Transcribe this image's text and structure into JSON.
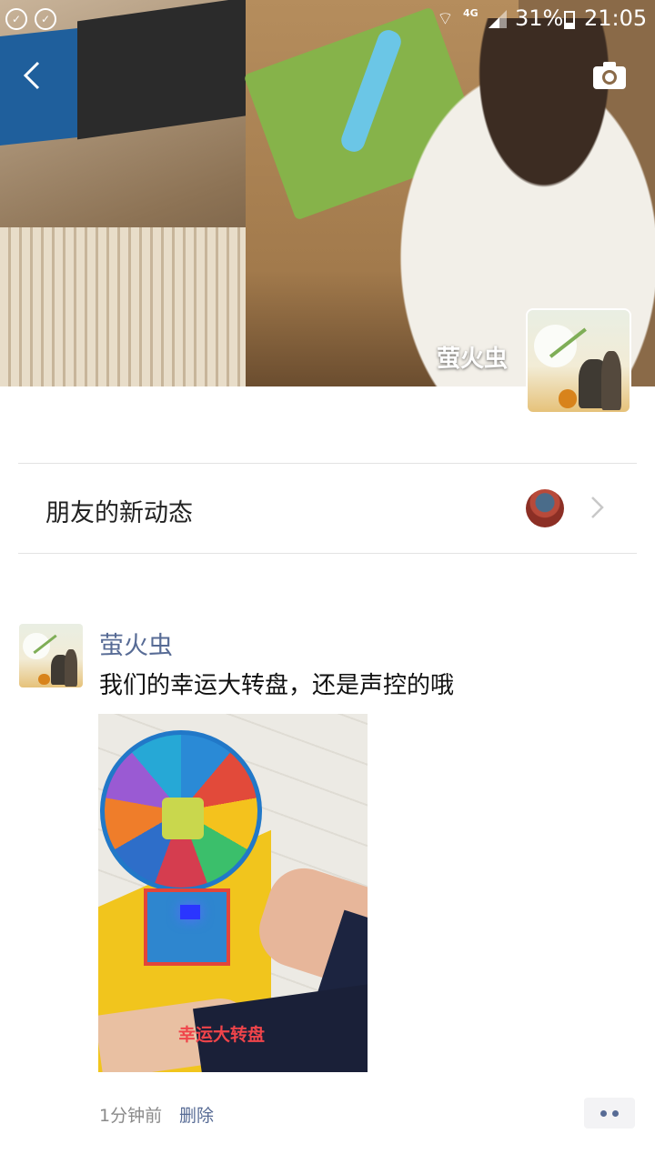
{
  "status_bar": {
    "network": "4G",
    "battery_percent": "31%",
    "battery_level": 0.31,
    "time": "21:05",
    "notification_icons": [
      "notification-icon",
      "notification-icon"
    ]
  },
  "header": {
    "cover_name": "萤火虫",
    "back_icon": "chevron-left-icon",
    "camera_icon": "camera-icon"
  },
  "friends_updates": {
    "label": "朋友的新动态",
    "chevron_icon": "chevron-right-icon"
  },
  "post": {
    "author": "萤火虫",
    "text": "我们的幸运大转盘，还是声控的哦",
    "image_caption": "幸运大转盘",
    "time": "1分钟前",
    "delete_label": "删除",
    "more_icon": "more-dots-icon"
  },
  "colors": {
    "link": "#576b95",
    "divider": "#e3e3e3",
    "caption_red": "#f0444a"
  }
}
